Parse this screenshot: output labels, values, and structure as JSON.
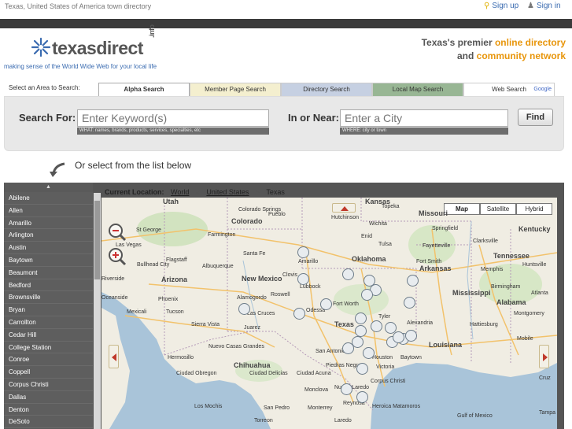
{
  "topbar": {
    "breadcrumb": "Texas, United States of America town directory",
    "signup": "Sign up",
    "signin": "Sign in"
  },
  "logo": {
    "text": "texasdirect",
    "suffix": ".info",
    "tagline": "making sense of the World Wide Web for your local life"
  },
  "premier": {
    "line1_a": "Texas's premier ",
    "line1_b": "online directory",
    "line2_a": "and ",
    "line2_b": "community network"
  },
  "search": {
    "area_label": "Select an Area to Search:",
    "tabs": [
      "Alpha Search",
      "Member Page Search",
      "Directory Search",
      "Local Map Search",
      "Web Search"
    ],
    "google": "Google",
    "for_label": "Search For:",
    "keyword_placeholder": "Enter Keyword(s)",
    "keyword_hint": "WHAT: names, brands, products, services, specialties, etc",
    "near_label": "In or Near:",
    "city_placeholder": "Enter a City",
    "city_hint": "WHERE: city or town",
    "find": "Find"
  },
  "select_list_text": "Or select from the list below",
  "cities": [
    "Abilene",
    "Allen",
    "Amarillo",
    "Arlington",
    "Austin",
    "Baytown",
    "Beaumont",
    "Bedford",
    "Brownsville",
    "Bryan",
    "Carrollton",
    "Cedar Hill",
    "College Station",
    "Conroe",
    "Coppell",
    "Corpus Christi",
    "Dallas",
    "Denton",
    "DeSoto"
  ],
  "location": {
    "label": "Current Location:",
    "world": "World",
    "us": "United States",
    "current": "Texas"
  },
  "map": {
    "types": [
      "Map",
      "Satellite",
      "Hybrid"
    ],
    "labels": {
      "utah": "Utah",
      "colorado_springs": "Colorado Springs",
      "pueblo": "Pueblo",
      "colorado": "Colorado",
      "kansas": "Kansas",
      "hutchinson": "Hutchinson",
      "wichita": "Wichita",
      "topeka": "Topeka",
      "missouri": "Missouri",
      "st_george": "St George",
      "farmington": "Farmington",
      "tulsa": "Tulsa",
      "springfield": "Springfield",
      "kentucky": "Kentucky",
      "las_vegas": "Las Vegas",
      "santa_fe": "Santa Fe",
      "enid": "Enid",
      "fayetteville": "Fayetteville",
      "clarksville": "Clarksville",
      "tennessee": "Tennessee",
      "flagstaff": "Flagstaff",
      "bullhead": "Bullhead City",
      "albuquerque": "Albuquerque",
      "amarillo": "Amarillo",
      "oklahoma": "Oklahoma",
      "fort_smith": "Fort Smith",
      "arkansas": "Arkansas",
      "memphis": "Memphis",
      "huntsville": "Huntsville",
      "arizona": "Arizona",
      "new_mexico": "New Mexico",
      "clovis": "Clovis",
      "lubbock": "Lubbock",
      "riverside": "Riverside",
      "oceanside": "Oceanside",
      "phoenix": "Phoenix",
      "roswell": "Roswell",
      "alamogordo": "Alamogordo",
      "fort_worth": "Fort Worth",
      "birmingham": "Birmingham",
      "mississippi": "Mississippi",
      "alabama": "Alabama",
      "atlanta": "Atlanta",
      "mexicali": "Mexicali",
      "tucson": "Tucson",
      "las_cruces": "Las Cruces",
      "juarez": "Juarez",
      "odessa": "Odessa",
      "texas": "Texas",
      "tyler": "Tyler",
      "alexandria": "Alexandria",
      "montgomery": "Montgomery",
      "hattiesburg": "Hattiesburg",
      "sierra_vista": "Sierra Vista",
      "hermosillo": "Hermosillo",
      "chihuahua": "Chihuahua",
      "san_antonio": "San Antonio",
      "houston": "Houston",
      "louisiana": "Louisiana",
      "mobile": "Mobile",
      "nuevo_casas": "Nuevo Casas Grandes",
      "baytown": "Baytown",
      "victoria": "Victoria",
      "corpus_christi": "Corpus Christi",
      "piedras_negras": "Piedras Negras",
      "nuevo_laredo": "Nuevo Laredo",
      "ciudad_obregon": "Ciudad Obregon",
      "ciudad_delicias": "Ciudad Delicias",
      "ciudad_acuna": "Ciudad Acuna",
      "monclova": "Monclova",
      "los_mochis": "Los Mochis",
      "heroica": "Heroica Matamoros",
      "monterrey": "Monterrey",
      "reynosa": "Reynosa",
      "san_pedro": "San Pedro",
      "gulf_of_mexico": "Gulf of Mexico",
      "cruz": "Cruz",
      "torreon": "Torreon",
      "laredo": "Laredo",
      "tampa": "Tampa"
    }
  }
}
